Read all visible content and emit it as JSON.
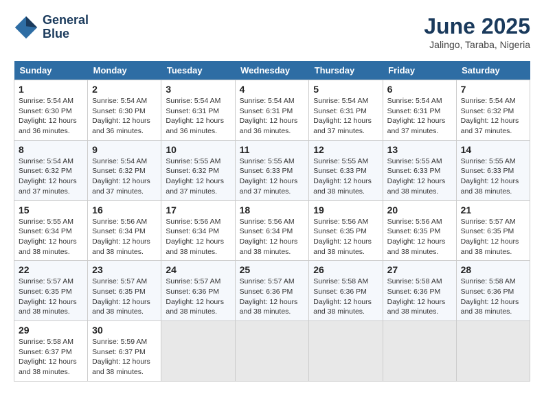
{
  "logo": {
    "line1": "General",
    "line2": "Blue"
  },
  "title": "June 2025",
  "subtitle": "Jalingo, Taraba, Nigeria",
  "days_of_week": [
    "Sunday",
    "Monday",
    "Tuesday",
    "Wednesday",
    "Thursday",
    "Friday",
    "Saturday"
  ],
  "weeks": [
    [
      {
        "day": "1",
        "sunrise": "5:54 AM",
        "sunset": "6:30 PM",
        "daylight_hours": "12 hours",
        "daylight_minutes": "36 minutes"
      },
      {
        "day": "2",
        "sunrise": "5:54 AM",
        "sunset": "6:30 PM",
        "daylight_hours": "12 hours",
        "daylight_minutes": "36 minutes"
      },
      {
        "day": "3",
        "sunrise": "5:54 AM",
        "sunset": "6:31 PM",
        "daylight_hours": "12 hours",
        "daylight_minutes": "36 minutes"
      },
      {
        "day": "4",
        "sunrise": "5:54 AM",
        "sunset": "6:31 PM",
        "daylight_hours": "12 hours",
        "daylight_minutes": "36 minutes"
      },
      {
        "day": "5",
        "sunrise": "5:54 AM",
        "sunset": "6:31 PM",
        "daylight_hours": "12 hours",
        "daylight_minutes": "37 minutes"
      },
      {
        "day": "6",
        "sunrise": "5:54 AM",
        "sunset": "6:31 PM",
        "daylight_hours": "12 hours",
        "daylight_minutes": "37 minutes"
      },
      {
        "day": "7",
        "sunrise": "5:54 AM",
        "sunset": "6:32 PM",
        "daylight_hours": "12 hours",
        "daylight_minutes": "37 minutes"
      }
    ],
    [
      {
        "day": "8",
        "sunrise": "5:54 AM",
        "sunset": "6:32 PM",
        "daylight_hours": "12 hours",
        "daylight_minutes": "37 minutes"
      },
      {
        "day": "9",
        "sunrise": "5:54 AM",
        "sunset": "6:32 PM",
        "daylight_hours": "12 hours",
        "daylight_minutes": "37 minutes"
      },
      {
        "day": "10",
        "sunrise": "5:55 AM",
        "sunset": "6:32 PM",
        "daylight_hours": "12 hours",
        "daylight_minutes": "37 minutes"
      },
      {
        "day": "11",
        "sunrise": "5:55 AM",
        "sunset": "6:33 PM",
        "daylight_hours": "12 hours",
        "daylight_minutes": "37 minutes"
      },
      {
        "day": "12",
        "sunrise": "5:55 AM",
        "sunset": "6:33 PM",
        "daylight_hours": "12 hours",
        "daylight_minutes": "38 minutes"
      },
      {
        "day": "13",
        "sunrise": "5:55 AM",
        "sunset": "6:33 PM",
        "daylight_hours": "12 hours",
        "daylight_minutes": "38 minutes"
      },
      {
        "day": "14",
        "sunrise": "5:55 AM",
        "sunset": "6:33 PM",
        "daylight_hours": "12 hours",
        "daylight_minutes": "38 minutes"
      }
    ],
    [
      {
        "day": "15",
        "sunrise": "5:55 AM",
        "sunset": "6:34 PM",
        "daylight_hours": "12 hours",
        "daylight_minutes": "38 minutes"
      },
      {
        "day": "16",
        "sunrise": "5:56 AM",
        "sunset": "6:34 PM",
        "daylight_hours": "12 hours",
        "daylight_minutes": "38 minutes"
      },
      {
        "day": "17",
        "sunrise": "5:56 AM",
        "sunset": "6:34 PM",
        "daylight_hours": "12 hours",
        "daylight_minutes": "38 minutes"
      },
      {
        "day": "18",
        "sunrise": "5:56 AM",
        "sunset": "6:34 PM",
        "daylight_hours": "12 hours",
        "daylight_minutes": "38 minutes"
      },
      {
        "day": "19",
        "sunrise": "5:56 AM",
        "sunset": "6:35 PM",
        "daylight_hours": "12 hours",
        "daylight_minutes": "38 minutes"
      },
      {
        "day": "20",
        "sunrise": "5:56 AM",
        "sunset": "6:35 PM",
        "daylight_hours": "12 hours",
        "daylight_minutes": "38 minutes"
      },
      {
        "day": "21",
        "sunrise": "5:57 AM",
        "sunset": "6:35 PM",
        "daylight_hours": "12 hours",
        "daylight_minutes": "38 minutes"
      }
    ],
    [
      {
        "day": "22",
        "sunrise": "5:57 AM",
        "sunset": "6:35 PM",
        "daylight_hours": "12 hours",
        "daylight_minutes": "38 minutes"
      },
      {
        "day": "23",
        "sunrise": "5:57 AM",
        "sunset": "6:35 PM",
        "daylight_hours": "12 hours",
        "daylight_minutes": "38 minutes"
      },
      {
        "day": "24",
        "sunrise": "5:57 AM",
        "sunset": "6:36 PM",
        "daylight_hours": "12 hours",
        "daylight_minutes": "38 minutes"
      },
      {
        "day": "25",
        "sunrise": "5:57 AM",
        "sunset": "6:36 PM",
        "daylight_hours": "12 hours",
        "daylight_minutes": "38 minutes"
      },
      {
        "day": "26",
        "sunrise": "5:58 AM",
        "sunset": "6:36 PM",
        "daylight_hours": "12 hours",
        "daylight_minutes": "38 minutes"
      },
      {
        "day": "27",
        "sunrise": "5:58 AM",
        "sunset": "6:36 PM",
        "daylight_hours": "12 hours",
        "daylight_minutes": "38 minutes"
      },
      {
        "day": "28",
        "sunrise": "5:58 AM",
        "sunset": "6:36 PM",
        "daylight_hours": "12 hours",
        "daylight_minutes": "38 minutes"
      }
    ],
    [
      {
        "day": "29",
        "sunrise": "5:58 AM",
        "sunset": "6:37 PM",
        "daylight_hours": "12 hours",
        "daylight_minutes": "38 minutes"
      },
      {
        "day": "30",
        "sunrise": "5:59 AM",
        "sunset": "6:37 PM",
        "daylight_hours": "12 hours",
        "daylight_minutes": "38 minutes"
      },
      null,
      null,
      null,
      null,
      null
    ]
  ]
}
